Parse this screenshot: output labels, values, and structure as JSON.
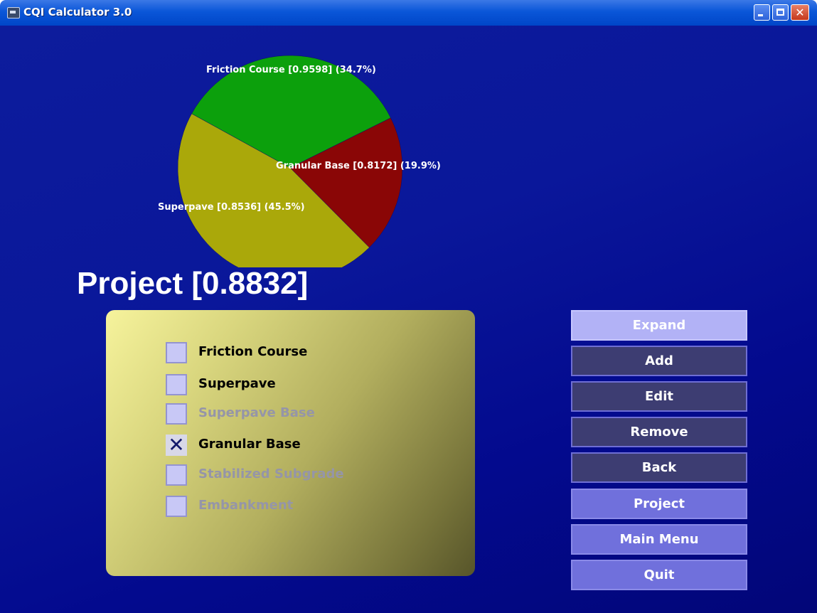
{
  "window": {
    "title": "CQI Calculator 3.0",
    "close_glyph": "✕"
  },
  "chart_data": {
    "type": "pie",
    "slices": [
      {
        "label": "Friction Course [0.9598] (34.7%)",
        "value": 34.7,
        "color": "#0ca00c"
      },
      {
        "label": "Granular Base [0.8172] (19.9%)",
        "value": 19.9,
        "color": "#8a0606"
      },
      {
        "label": "Superpave [0.8536] (45.5%)",
        "value": 45.5,
        "color": "#aaa80a"
      }
    ]
  },
  "project": {
    "title": "Project [0.8832]"
  },
  "layers": [
    {
      "label": "Friction Course",
      "checked": false,
      "enabled": true
    },
    {
      "label": "Superpave",
      "checked": false,
      "enabled": true
    },
    {
      "label": "Superpave Base",
      "checked": false,
      "enabled": false
    },
    {
      "label": "Granular Base",
      "checked": true,
      "enabled": true,
      "mark": "✕"
    },
    {
      "label": "Stabilized Subgrade",
      "checked": false,
      "enabled": false
    },
    {
      "label": "Embankment",
      "checked": false,
      "enabled": false
    }
  ],
  "buttons": {
    "expand": "Expand",
    "add": "Add",
    "edit": "Edit",
    "remove": "Remove",
    "back": "Back",
    "project": "Project",
    "main_menu": "Main Menu",
    "quit": "Quit"
  },
  "colors": {
    "background": "#0a179a",
    "button_light": "#b2b2f6",
    "button_dark": "#3d3d72",
    "button_mid": "#7070dc"
  }
}
